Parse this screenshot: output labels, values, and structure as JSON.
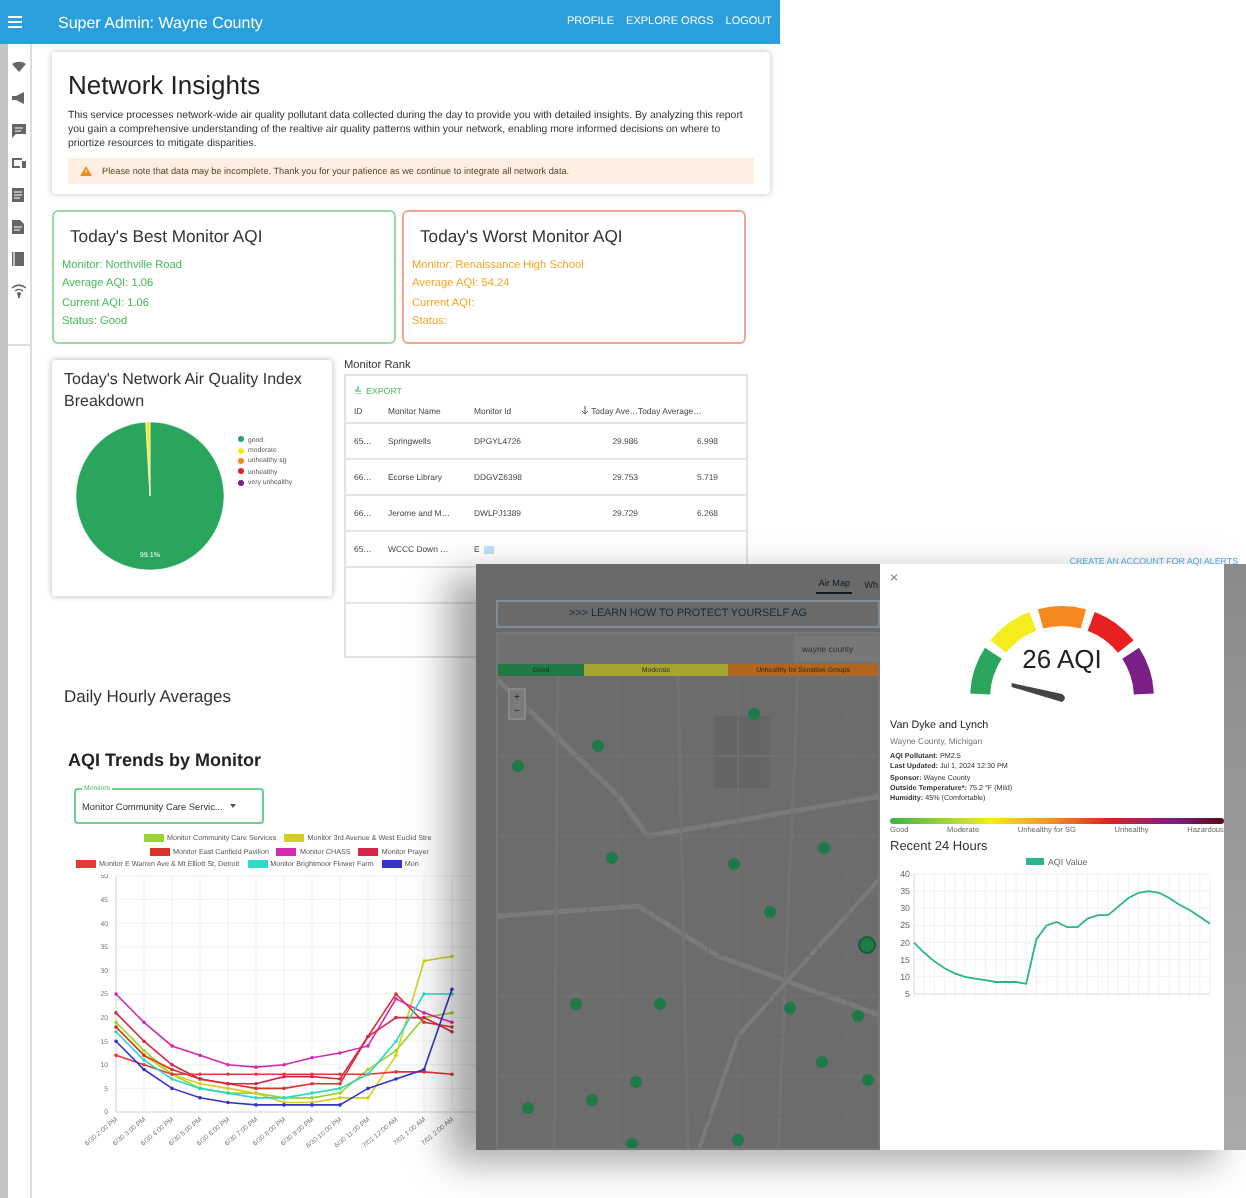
{
  "header": {
    "title": "Super Admin: Wayne County",
    "links": [
      "PROFILE",
      "EXPLORE ORGS",
      "LOGOUT"
    ]
  },
  "insights": {
    "title": "Network Insights",
    "description": "This service processes network-wide air quality pollutant data collected during the day to provide you with detailed insights. By analyzing this report you gain a comprehensive understanding of the realtive air quality patterns within your network, enabling more informed decisions on where to priortize resources to mitigate disparities.",
    "notice": "Please note that data may be incomplete. Thank you for your patience as we continue to integrate all network data."
  },
  "summary_cards": [
    {
      "kind": "best",
      "title": "Today's Best Monitor AQI",
      "lines": [
        "Monitor: Northville Road",
        "Average AQI: 1.06",
        "Current AQI: 1.06",
        "Status: Good"
      ]
    },
    {
      "kind": "worst",
      "title": "Today's Worst Monitor AQI",
      "lines": [
        "Monitor: Renaissance High School",
        "Average AQI: 54.24",
        "Current AQI:",
        "Status:"
      ]
    }
  ],
  "breakdown": {
    "title": "Today's Network Air Quality Index Breakdown",
    "chart_data": {
      "type": "pie",
      "categories": [
        "good",
        "moderate",
        "unhealthy sg",
        "unhealthy",
        "very unhealthy"
      ],
      "values": [
        99.1,
        0.9,
        0,
        0,
        0
      ],
      "colors": [
        "#2aa55e",
        "#f4ec1c",
        "#f5891f",
        "#e8201f",
        "#7b1f86"
      ],
      "value_labels": [
        "99.1%",
        null,
        null,
        null,
        null
      ]
    }
  },
  "monitor_rank": {
    "title": "Monitor Rank",
    "export": "EXPORT",
    "columns": [
      {
        "label": "ID",
        "sorted": false
      },
      {
        "label": "Monitor Name",
        "sorted": false
      },
      {
        "label": "Monitor Id",
        "sorted": false
      },
      {
        "label": "Today Ave…",
        "sorted": true
      },
      {
        "label": "Today Average…",
        "sorted": false
      }
    ],
    "rows": [
      [
        "65…",
        "Springwells",
        "DPGYL4726",
        "29.986",
        "6.998"
      ],
      [
        "66…",
        "Ecorse Library",
        "DDGVZ6398",
        "29.753",
        "5.719"
      ],
      [
        "66…",
        "Jerome and M…",
        "DWLPJ1389",
        "29.729",
        "6.268"
      ],
      [
        "65…",
        "WCCC Down …",
        "E",
        "",
        ""
      ]
    ]
  },
  "daily": {
    "title": "Daily Hourly Averages"
  },
  "trends": {
    "title": "AQI Trends by Monitor",
    "select": {
      "label": "Monitors",
      "value": "Monitor Community Care Servic..."
    },
    "chart_data": {
      "type": "line",
      "grid": true,
      "categories": [
        "6/30 2:00 PM",
        "6/30 3:00 PM",
        "6/30 4:00 PM",
        "6/30 5:00 PM",
        "6/30 6:00 PM",
        "6/30 7:00 PM",
        "6/30 8:00 PM",
        "6/30 9:00 PM",
        "6/30 10:00 PM",
        "6/30 11:00 PM",
        "7/01 12:00 AM",
        "7/01 1:00 AM",
        "7/01 2:00 AM"
      ],
      "ylim": [
        0,
        50
      ],
      "yticks": [
        0,
        5,
        10,
        15,
        20,
        25,
        30,
        35,
        40,
        45,
        50
      ],
      "series": [
        {
          "name": "Monitor Community Care Services",
          "color": "#98d42a",
          "values": [
            19,
            13,
            8,
            5,
            4,
            4,
            3,
            3,
            4,
            9,
            13,
            20,
            21
          ]
        },
        {
          "name": "Monitor 3rd Avenue & West Euclid Stre",
          "color": "#d4cf1e",
          "values": [
            18,
            12,
            8,
            6,
            5,
            4,
            2,
            2,
            3,
            3,
            12,
            32,
            33
          ]
        },
        {
          "name": "Monitor East Canfield Pavilion",
          "color": "#d9342b",
          "values": [
            18,
            12,
            9,
            7,
            6,
            5,
            5,
            6,
            6,
            16,
            25,
            19,
            18
          ]
        },
        {
          "name": "Monitor CHASS",
          "color": "#d42ab0",
          "values": [
            25,
            19,
            14,
            12,
            10,
            9.5,
            10,
            11.5,
            12.5,
            14,
            24,
            21,
            19
          ]
        },
        {
          "name": "Monitor Prayer",
          "color": "#d8254a",
          "values": [
            21,
            15,
            10,
            7,
            6,
            6,
            7.5,
            7.5,
            7,
            16,
            20,
            20,
            17
          ]
        },
        {
          "name": "Monitor E Warren Ave & Mt Elliott St, Detroit",
          "color": "#e03a3a",
          "values": [
            12,
            10,
            8,
            8,
            8,
            8,
            8,
            8,
            8,
            8,
            8.5,
            8.5,
            8
          ]
        },
        {
          "name": "Monitor Brightmoor Flower Farm",
          "color": "#2ed8c8",
          "values": [
            17,
            11,
            7,
            5,
            4,
            3,
            3,
            4,
            5,
            8,
            15,
            25,
            25
          ]
        },
        {
          "name": "Mon",
          "color": "#3434c8",
          "values": [
            15,
            9,
            5,
            3,
            2,
            1.5,
            1.5,
            1.5,
            1.5,
            5,
            7,
            9,
            26
          ]
        }
      ]
    }
  },
  "map_page": {
    "account_link": "CREATE AN ACCOUNT FOR AQI ALERTS",
    "tabs": [
      {
        "label": "Air Map",
        "selected": true
      },
      {
        "label": "Wh",
        "selected": false
      }
    ],
    "banner": ">>> LEARN HOW TO PROTECT YOURSELF AG",
    "search": {
      "value": "wayne county"
    },
    "legend": [
      {
        "label": "Good",
        "color": "#1f7a45"
      },
      {
        "label": "Moderate",
        "color": "#a7a532"
      },
      {
        "label": "Unhealthy for Sensitive Groups",
        "color": "#b0661f"
      }
    ],
    "zoom": [
      "+",
      "−"
    ],
    "map": {
      "kind": "picture"
    }
  },
  "station": {
    "close": "×",
    "aqi": "26 AQI",
    "name": "Van Dyke and Lynch",
    "location": "Wayne County, Michigan",
    "details": [
      "**AQI Pollutant:** PM2.5",
      "**Last Updated:** Jul 1, 2024 12:30 PM",
      "**Sponsor:** Wayne County",
      "**Outside Temperature*:** 75.2 °F (Mild)",
      "**Humidity:** 45% (Comfortable)"
    ],
    "scale_labels": [
      "Good",
      "Moderate",
      "Unhealthy for SG",
      "Unhealthy",
      "Hazardous"
    ],
    "recent_title": "Recent 24 Hours",
    "chart_data": {
      "type": "line",
      "grid": true,
      "ylim": [
        5,
        40
      ],
      "yticks": [
        5,
        10,
        15,
        20,
        25,
        30,
        35,
        40
      ],
      "series": [
        {
          "name": "AQI Value",
          "color": "#2bb58a",
          "values": [
            20,
            17,
            14.5,
            12.5,
            11,
            10,
            9.5,
            9,
            8.5,
            8.5,
            8.5,
            8,
            21,
            25,
            26,
            24.5,
            24.5,
            27,
            28,
            28,
            30.5,
            33,
            34.5,
            35,
            34.5,
            33,
            31,
            29.5,
            27.5,
            25.5
          ]
        }
      ]
    }
  }
}
